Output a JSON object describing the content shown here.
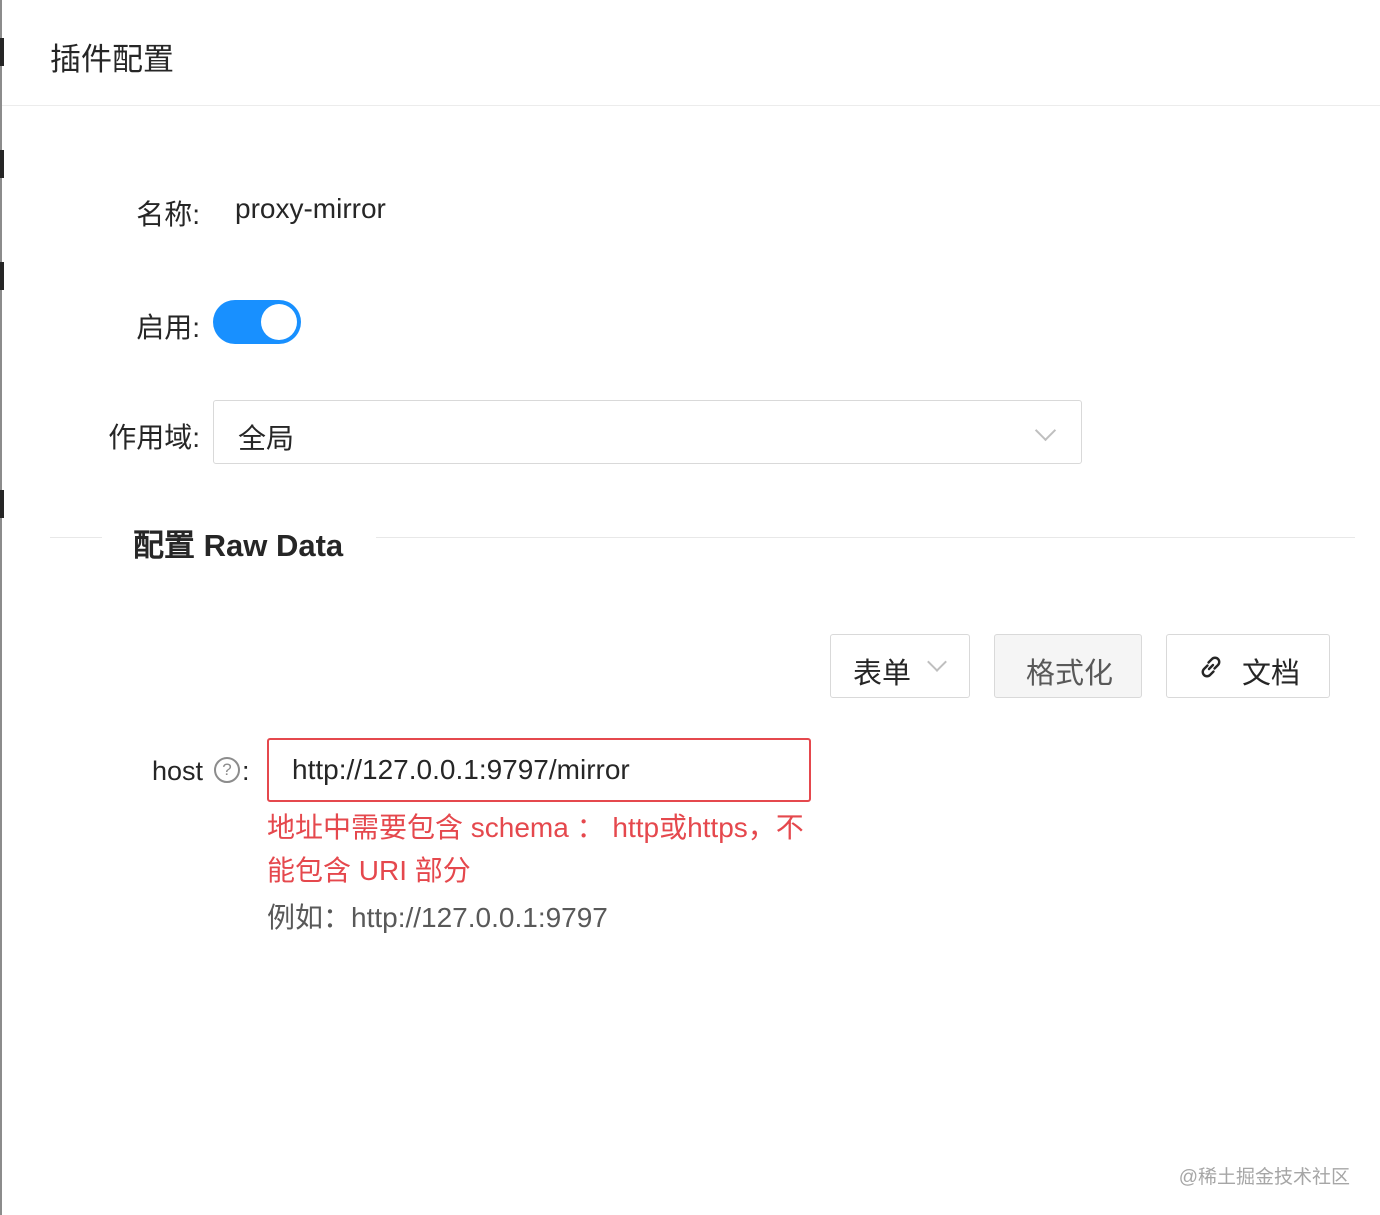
{
  "drawer": {
    "title": "插件配置"
  },
  "form": {
    "name_label": "名称",
    "name_value": "proxy-mirror",
    "enable_label": "启用",
    "enabled": true,
    "scope_label": "作用域",
    "scope_value": "全局"
  },
  "section": {
    "title": "配置 Raw Data"
  },
  "toolbar": {
    "mode_label": "表单",
    "format_label": "格式化",
    "docs_label": "文档"
  },
  "host_field": {
    "label": "host",
    "help_glyph": "?",
    "value": "http://127.0.0.1:9797/mirror",
    "error": "地址中需要包含 schema ： http或https，不能包含 URI 部分",
    "example": "例如：http://127.0.0.1:9797"
  },
  "watermark": "@稀土掘金技术社区",
  "colors": {
    "primary": "#1890ff",
    "error": "#e5484d",
    "border": "#d9d9d9"
  },
  "icons": {
    "select_arrow": "chevron-down-icon",
    "docs": "link-icon",
    "help": "question-circle-icon"
  }
}
